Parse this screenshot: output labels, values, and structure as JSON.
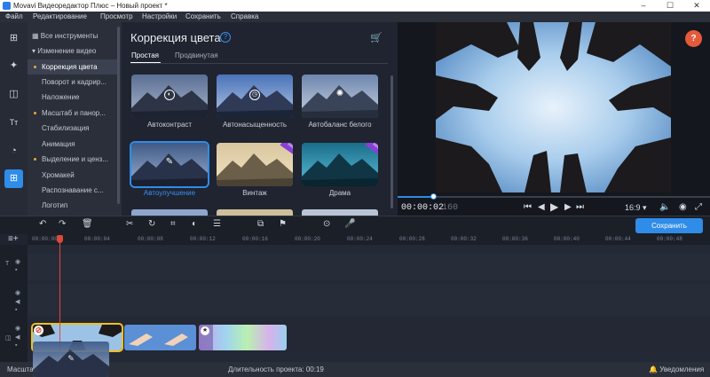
{
  "window": {
    "title": "Movavi Видеоредактор Плюс – Новый проект *",
    "minimize": "–",
    "maximize": "☐",
    "close": "✕"
  },
  "menu": [
    "Файл",
    "Редактирование",
    "Просмотр",
    "Настройки",
    "Сохранить",
    "Справка"
  ],
  "toolbar": [
    {
      "icon": "import-icon",
      "glyph": "⊞"
    },
    {
      "icon": "magic-wand-icon",
      "glyph": "✦"
    },
    {
      "icon": "transitions-icon",
      "glyph": "◫"
    },
    {
      "icon": "titles-icon",
      "glyph": "Tт"
    },
    {
      "icon": "stickers-icon",
      "glyph": "◔"
    },
    {
      "icon": "more-tools-icon",
      "glyph": "⊞",
      "active": true
    }
  ],
  "sidenav": {
    "items": [
      {
        "label": "Все инструменты",
        "prefix": "▦"
      },
      {
        "label": "Изменение видео",
        "prefix": "▾"
      },
      {
        "label": "Коррекция цвета",
        "dot": true,
        "selected": true
      },
      {
        "label": "Поворот и кадрир..."
      },
      {
        "label": "Наложение"
      },
      {
        "label": "Масштаб и панор...",
        "dot": true
      },
      {
        "label": "Стабилизация"
      },
      {
        "label": "Анимация"
      },
      {
        "label": "Выделение и ценз...",
        "dot": true
      },
      {
        "label": "Хромакей"
      },
      {
        "label": "Распознавание с..."
      },
      {
        "label": "Логотип"
      }
    ]
  },
  "panel": {
    "title": "Коррекция цвета",
    "help": "?",
    "cart": "🛒",
    "tabs": [
      {
        "label": "Простая",
        "active": true
      },
      {
        "label": "Продвинутая"
      }
    ],
    "presets": [
      {
        "label": "Автоконтраст",
        "icon": "contrast-icon",
        "glyph": "◐"
      },
      {
        "label": "Автонасыщенность",
        "icon": "gauge-icon",
        "glyph": "◷"
      },
      {
        "label": "Автобаланс белого",
        "icon": "bulb-icon",
        "glyph": "✺"
      },
      {
        "label": "Автоулучшение",
        "icon": "magic-wand-icon",
        "glyph": "✎",
        "selected": true
      },
      {
        "label": "Винтаж",
        "pro": true
      },
      {
        "label": "Драма",
        "pro": true
      }
    ]
  },
  "preview": {
    "help": "?",
    "time_current": "00:00:02",
    "time_frame": "160",
    "aspect": "16:9 ▾",
    "controls": [
      "⏮",
      "◀",
      "▶",
      "▶",
      "⏭"
    ]
  },
  "timeline": {
    "save_label": "Сохранить",
    "ruler": [
      "00:00:00",
      "00:00:04",
      "00:00:08",
      "00:00:12",
      "00:00:16",
      "00:00:20",
      "00:00:24",
      "00:00:28",
      "00:00:32",
      "00:00:36",
      "00:00:40",
      "00:00:44",
      "00:00:48"
    ],
    "tool_glyphs": [
      "↶",
      "↷",
      "🗑",
      "✂",
      "↻",
      "⌗",
      "◐",
      "☰",
      "⧉",
      "⚑",
      "⊙",
      "🎤"
    ]
  },
  "status": {
    "left": "Масштаб:",
    "duration_label": "Длительность проекта:",
    "duration_value": "00:19",
    "notifications": "Уведомления"
  },
  "colors": {
    "accent": "#2f8ce8",
    "playhead": "#e0483a",
    "pro_badge": "#8b3fd6",
    "help": "#e55a3a",
    "dot": "#f0a830"
  }
}
